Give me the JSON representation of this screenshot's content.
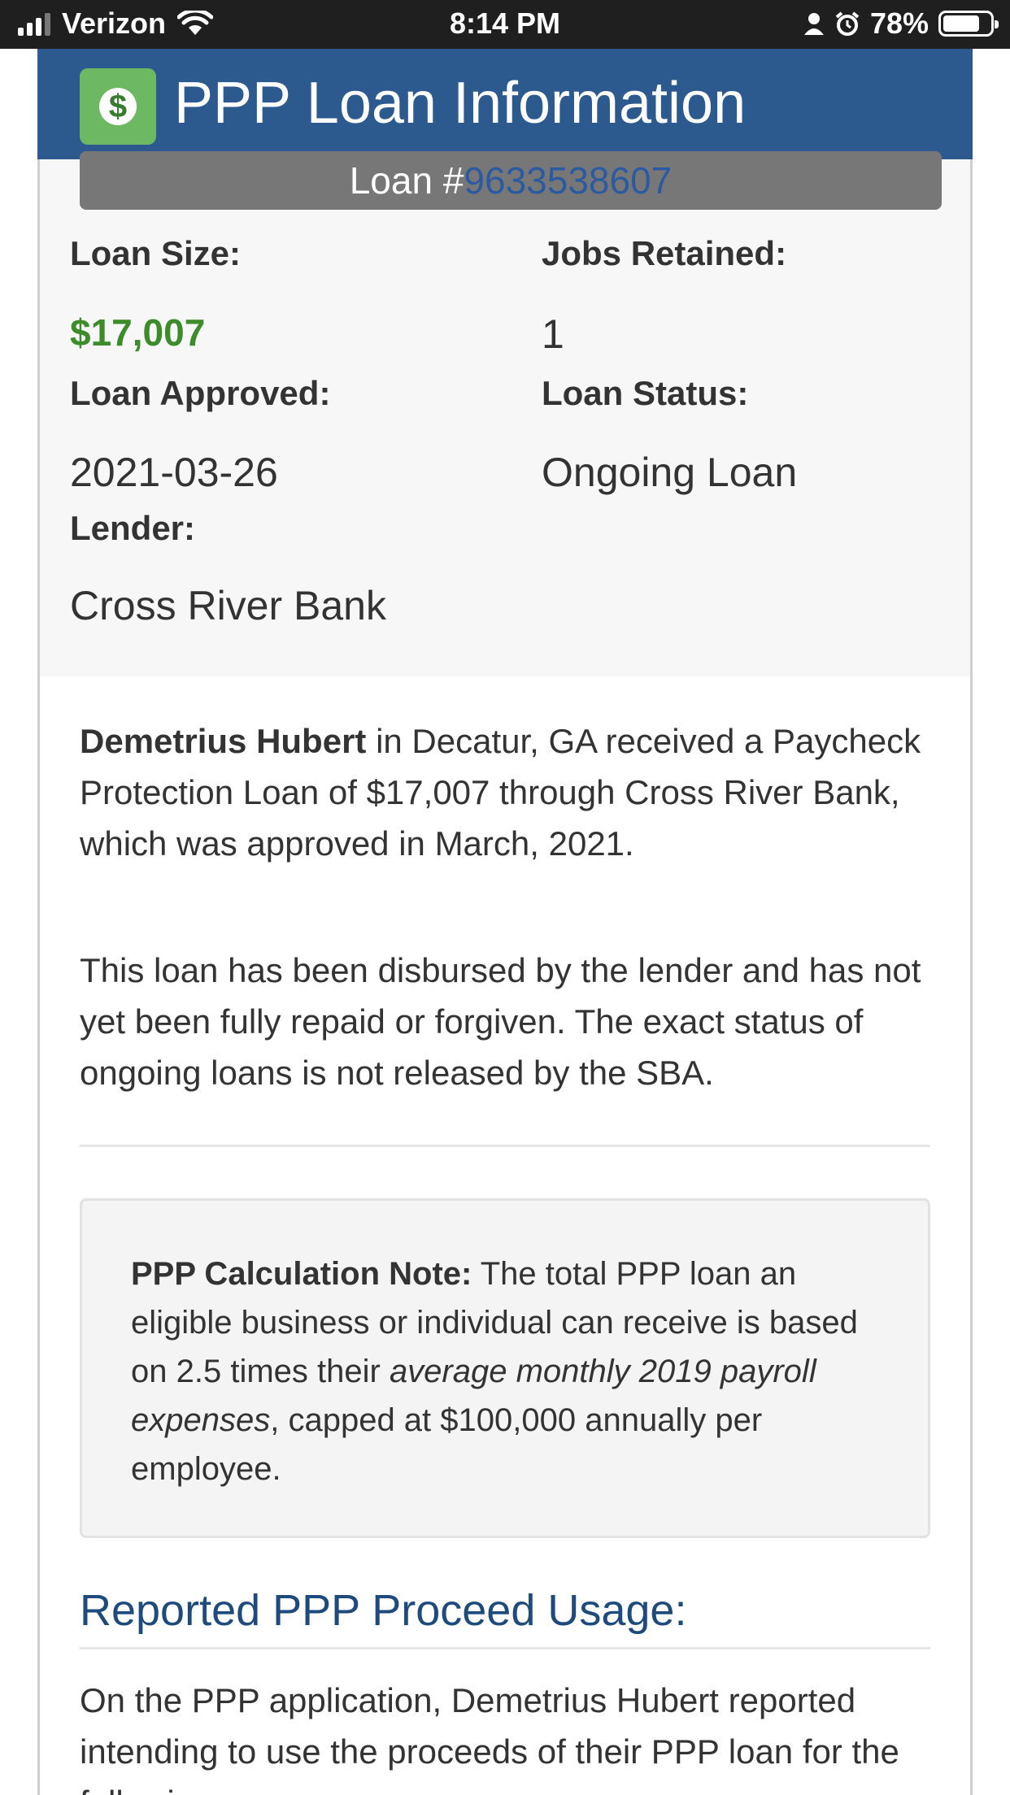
{
  "status_bar": {
    "carrier": "Verizon",
    "time": "8:14 PM",
    "battery": "78%",
    "battery_level": 0.78
  },
  "header": {
    "title": "PPP Loan Information",
    "badge_symbol": "$"
  },
  "loan_bar": {
    "prefix": "Loan #",
    "number": "9633538607"
  },
  "fields": {
    "loan_size_label": "Loan Size:",
    "loan_size_value": "$17,007",
    "jobs_retained_label": "Jobs Retained:",
    "jobs_retained_value": "1",
    "loan_approved_label": "Loan Approved:",
    "loan_approved_value": "2021-03-26",
    "loan_status_label": "Loan Status:",
    "loan_status_value": "Ongoing Loan",
    "lender_label": "Lender:",
    "lender_value": "Cross River Bank"
  },
  "summary": {
    "name": "Demetrius Hubert",
    "text": " in Decatur, GA received a Paycheck Protection Loan of $17,007 through Cross River Bank, which was approved in March, 2021."
  },
  "status_paragraph": "This loan has been disbursed by the lender and has not yet been fully repaid or forgiven. The exact status of ongoing loans is not released by the SBA.",
  "note": {
    "label": "PPP Calculation Note:",
    "text_before": " The total PPP loan an eligible business or individual can receive is based on 2.5 times their ",
    "emphasis": "average monthly 2019 payroll expenses",
    "text_after": ", capped at $100,000 annually per employee."
  },
  "usage": {
    "title": "Reported PPP Proceed Usage:",
    "intro": "On the PPP application, Demetrius Hubert reported intending to use the proceeds of their PPP loan for the following:"
  },
  "colors": {
    "header_bg": "#2c5a8e",
    "badge_bg": "#6db862",
    "money_green": "#3d8b2a",
    "loan_number_link": "#2c5aa0",
    "section_title": "#1f4a7c"
  }
}
